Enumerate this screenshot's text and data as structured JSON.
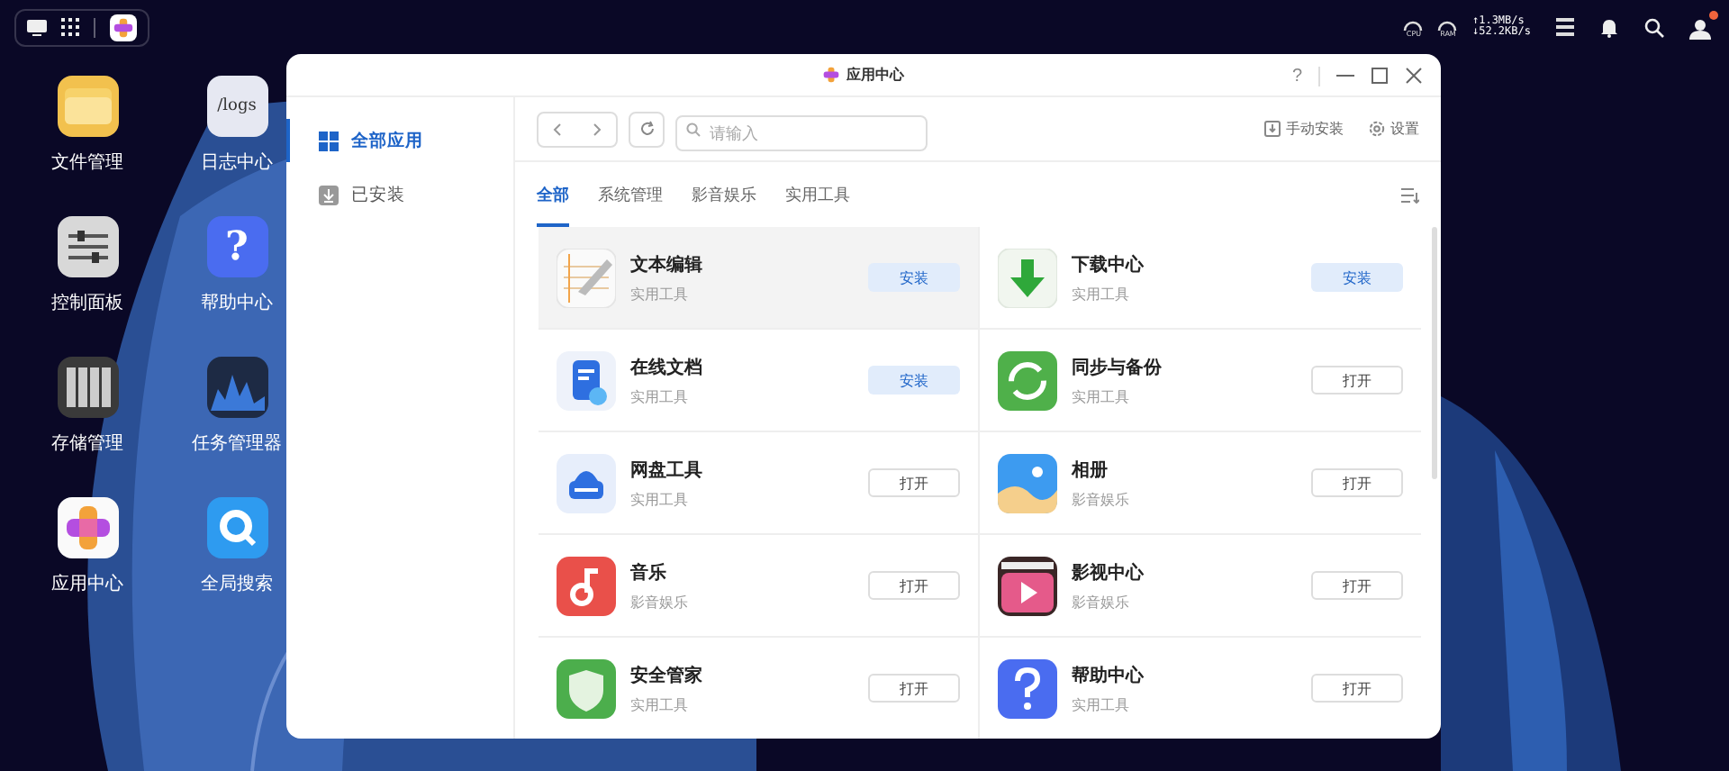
{
  "top_bar": {
    "gauges": [
      "CPU",
      "RAM"
    ],
    "speed_up": "↑1.3MB/s",
    "speed_down": "↓52.2KB/s",
    "user_alert": true
  },
  "desktop_icons": [
    {
      "label": "文件管理"
    },
    {
      "label": "控制面板"
    },
    {
      "label": "存储管理"
    },
    {
      "label": "应用中心"
    },
    {
      "label": "日志中心",
      "icon_text": "/logs"
    },
    {
      "label": "帮助中心",
      "icon_text": "?"
    },
    {
      "label": "任务管理器"
    },
    {
      "label": "全局搜索"
    }
  ],
  "window": {
    "title": "应用中心",
    "help": "?"
  },
  "sidebar": {
    "items": [
      {
        "label": "全部应用",
        "selected": true
      },
      {
        "label": "已安装",
        "selected": false
      }
    ]
  },
  "toolbar": {
    "search": {
      "placeholder": "请输入"
    },
    "actions": [
      "手动安装",
      "设置"
    ]
  },
  "tabs": [
    {
      "label": "全部",
      "selected": true
    },
    {
      "label": "系统管理",
      "selected": false
    },
    {
      "label": "影音娱乐",
      "selected": false
    },
    {
      "label": "实用工具",
      "selected": false
    }
  ],
  "apps": [
    {
      "name": "文本编辑",
      "category": "实用工具",
      "highlighted": true,
      "button": {
        "label": "安装",
        "kind": "install"
      }
    },
    {
      "name": "下载中心",
      "category": "实用工具",
      "highlighted": false,
      "button": {
        "label": "安装",
        "kind": "install"
      }
    },
    {
      "name": "在线文档",
      "category": "实用工具",
      "highlighted": false,
      "button": {
        "label": "安装",
        "kind": "install"
      }
    },
    {
      "name": "同步与备份",
      "category": "实用工具",
      "highlighted": false,
      "button": {
        "label": "打开",
        "kind": "open"
      }
    },
    {
      "name": "网盘工具",
      "category": "实用工具",
      "highlighted": false,
      "button": {
        "label": "打开",
        "kind": "open"
      }
    },
    {
      "name": "相册",
      "category": "影音娱乐",
      "highlighted": false,
      "button": {
        "label": "打开",
        "kind": "open"
      }
    },
    {
      "name": "音乐",
      "category": "影音娱乐",
      "highlighted": false,
      "button": {
        "label": "打开",
        "kind": "open"
      }
    },
    {
      "name": "影视中心",
      "category": "影音娱乐",
      "highlighted": false,
      "button": {
        "label": "打开",
        "kind": "open"
      }
    },
    {
      "name": "安全管家",
      "category": "实用工具",
      "highlighted": false,
      "button": {
        "label": "打开",
        "kind": "open"
      }
    },
    {
      "name": "帮助中心",
      "category": "实用工具",
      "highlighted": false,
      "button": {
        "label": "打开",
        "kind": "open"
      }
    }
  ]
}
